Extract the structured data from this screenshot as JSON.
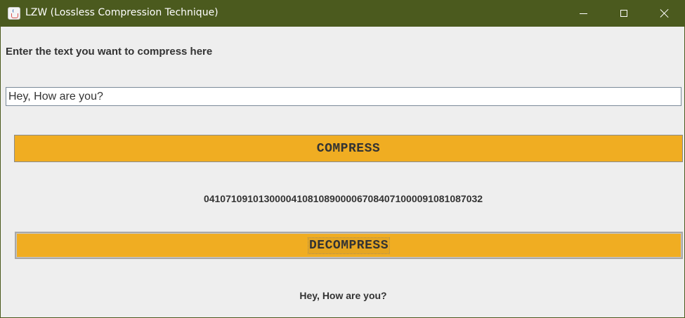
{
  "window": {
    "title": "LZW (Lossless Compression Technique)",
    "icon": "java-cup-icon",
    "controls": [
      "minimize-icon",
      "maximize-icon",
      "close-icon"
    ],
    "titlebar_color": "#4b5a1e"
  },
  "form": {
    "prompt_label": "Enter the text you want to compress here",
    "input_value": "Hey, How are you?",
    "compress_label": "COMPRESS",
    "compressed_output": "041071091013000041081089000067084071000091081087032",
    "decompress_label": "DECOMPRESS",
    "decompressed_output": "Hey, How are you?"
  },
  "colors": {
    "button_background": "#f0ad22",
    "window_background": "#eeeeee"
  }
}
